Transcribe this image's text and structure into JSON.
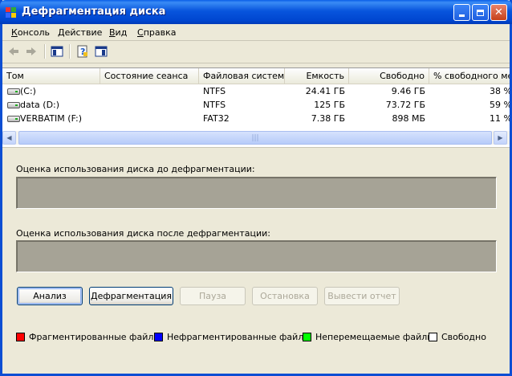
{
  "window": {
    "title": "Дефрагментация диска"
  },
  "menu": [
    "Консоль",
    "Действие",
    "Вид",
    "Справка"
  ],
  "menu_accel": [
    "К",
    "Д",
    "В",
    "С"
  ],
  "toolbar": {
    "icons": [
      "back-icon",
      "forward-icon",
      "show-hide-tree-icon",
      "help-icon",
      "properties-icon"
    ]
  },
  "table": {
    "columns": [
      "Том",
      "Состояние сеанса",
      "Файловая система",
      "Емкость",
      "Свободно",
      "% свободного места"
    ],
    "rows": [
      {
        "volume": "(C:)",
        "status": "",
        "fs": "NTFS",
        "capacity": "24.41 ГБ",
        "free": "9.46 ГБ",
        "pct": "38 %"
      },
      {
        "volume": "data (D:)",
        "status": "",
        "fs": "NTFS",
        "capacity": "125 ГБ",
        "free": "73.72 ГБ",
        "pct": "59 %"
      },
      {
        "volume": "VERBATIM (F:)",
        "status": "",
        "fs": "FAT32",
        "capacity": "7.38 ГБ",
        "free": "898 МБ",
        "pct": "11 %"
      }
    ]
  },
  "before_label": "Оценка использования диска до дефрагментации:",
  "after_label": "Оценка использования диска после дефрагментации:",
  "buttons": {
    "analyze": "Анализ",
    "defrag": "Дефрагментация",
    "pause": "Пауза",
    "stop": "Остановка",
    "report": "Вывести отчет"
  },
  "legend": [
    {
      "label": "Фрагментированные файлы",
      "color": "#ff0000"
    },
    {
      "label": "Нефрагментированные файлы",
      "color": "#0000ff"
    },
    {
      "label": "Неперемещаемые файлы",
      "color": "#00ff00"
    },
    {
      "label": "Свободно",
      "color": "#ffffff"
    }
  ]
}
